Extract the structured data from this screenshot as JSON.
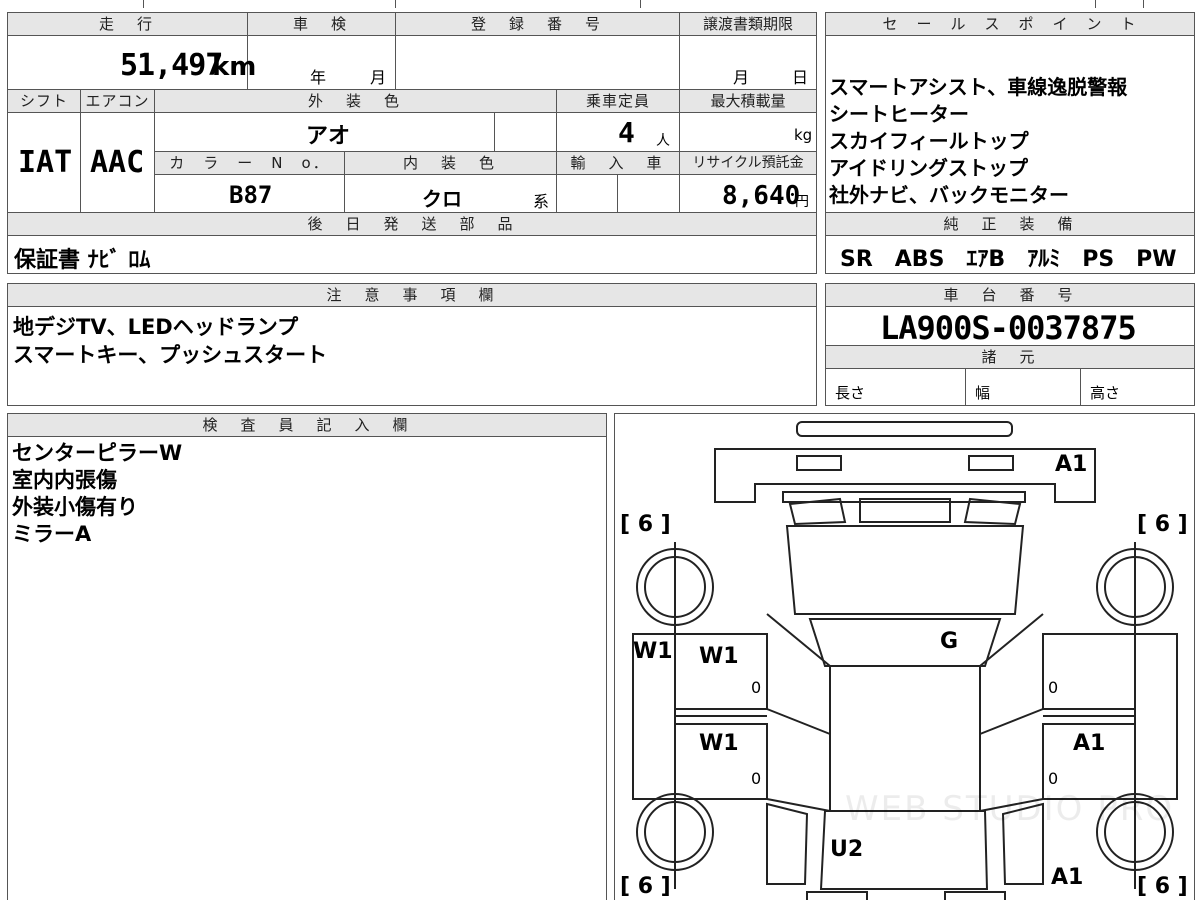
{
  "top_row": {
    "headers": {
      "mileage": "走　行",
      "inspection": "車　検",
      "registration": "登　録　番　号",
      "transfer_deadline": "譲渡書類期限"
    },
    "mileage_value": "51,497",
    "mileage_unit": "km",
    "inspection_year": "年",
    "inspection_month": "月",
    "deadline_month": "月",
    "deadline_day": "日"
  },
  "spec_row": {
    "headers": {
      "shift": "シフト",
      "aircon": "エアコン",
      "exterior_color": "外　装　色",
      "capacity": "乗車定員",
      "max_load": "最大積載量",
      "color_no": "カ　ラ　ー　N　o．",
      "interior_color": "内　装　色",
      "import": "輸　入　車",
      "recycle": "リサイクル預託金"
    },
    "shift_value": "IAT",
    "aircon_value": "AAC",
    "exterior_color_value": "アオ",
    "capacity_value": "4",
    "capacity_unit": "人",
    "max_load_unit": "kg",
    "color_no_value": "B87",
    "interior_color_value": "クロ",
    "interior_suffix": "系",
    "recycle_value": "8,640",
    "recycle_unit": "円"
  },
  "later_parts": {
    "header": "後　日　発　送　部　品",
    "value": "保証書 ﾅﾋﾞ ﾛﾑ"
  },
  "sales_points": {
    "header": "セ　ー　ル　ス　ポ　イ　ン　ト",
    "lines": [
      "スマートアシスト、車線逸脱警報",
      "シートヒーター",
      "スカイフィールトップ",
      "アイドリングストップ",
      "社外ナビ、バックモニター"
    ]
  },
  "factory_equipment": {
    "header": "純　正　装　備",
    "value": "SR　ABS　ｴｱB　ｱﾙﾐ　PS　PW"
  },
  "notes": {
    "header": "注　意　事　項　欄",
    "lines": [
      "地デジTV、LEDヘッドランプ",
      "スマートキー、プッシュスタート"
    ]
  },
  "chassis": {
    "header": "車　台　番　号",
    "value": "LA900S-0037875",
    "specs_header": "諸　元",
    "length": "長さ",
    "width": "幅",
    "height": "高さ"
  },
  "inspector": {
    "header": "検　査　員　記　入　欄",
    "lines": [
      "センターピラーW",
      "室内内張傷",
      "外装小傷有り",
      "ミラーA"
    ]
  },
  "diagram": {
    "marks": {
      "rear_right": "A1",
      "tire_top_left": "[ 6 ]",
      "tire_top_right": "[ 6 ]",
      "tire_bottom_left": "[ 6 ]",
      "tire_bottom_right": "[ 6 ]",
      "roof": "G",
      "left_side": "W1",
      "left_rear_door": "W1",
      "left_front_door": "W1",
      "right_front_door": "A1",
      "hood": "U2",
      "front_right": "A1",
      "zero_lr": "0",
      "zero_lf": "0",
      "zero_rr": "0",
      "zero_rf": "0"
    },
    "watermark": "WEB STUDIO PRO"
  }
}
